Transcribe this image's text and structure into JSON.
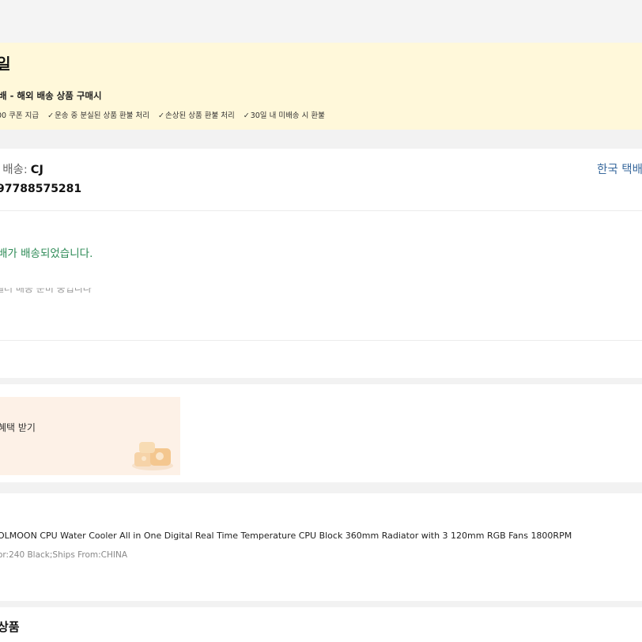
{
  "notice": {
    "title": "일",
    "subtitle": "배 - 해외 배송 상품 구매시",
    "benefits": [
      "00 쿠폰 지급",
      "운송 중 분실된 상품 환불 처리",
      "손상된 상품 환불 처리",
      "30일 내 미배송 시 환불"
    ]
  },
  "shipping": {
    "carrier_label": "· 배송:",
    "carrier_name": "CJ",
    "tracking_link": "한국 택배",
    "tracking_number": "97788575281",
    "status": "배가 배송되었습니다.",
    "prev_status": "셀러 배송 준비 중입니다"
  },
  "promo": {
    "text": "혜택 받기",
    "image_icon": "gift-box-icon"
  },
  "product": {
    "title": "OLMOON CPU Water Cooler All in One Digital Real Time Temperature CPU Block 360mm Radiator with 3 120mm RGB Fans 1800RPM",
    "variant": "or:240 Black;Ships From:CHINA"
  },
  "recommend": {
    "title": "상품"
  },
  "colors": {
    "notice_bg": "#fff8da",
    "status_green": "#2e8b57",
    "link_blue": "#3a6a9e",
    "promo_bg": "#fdf1e7"
  }
}
